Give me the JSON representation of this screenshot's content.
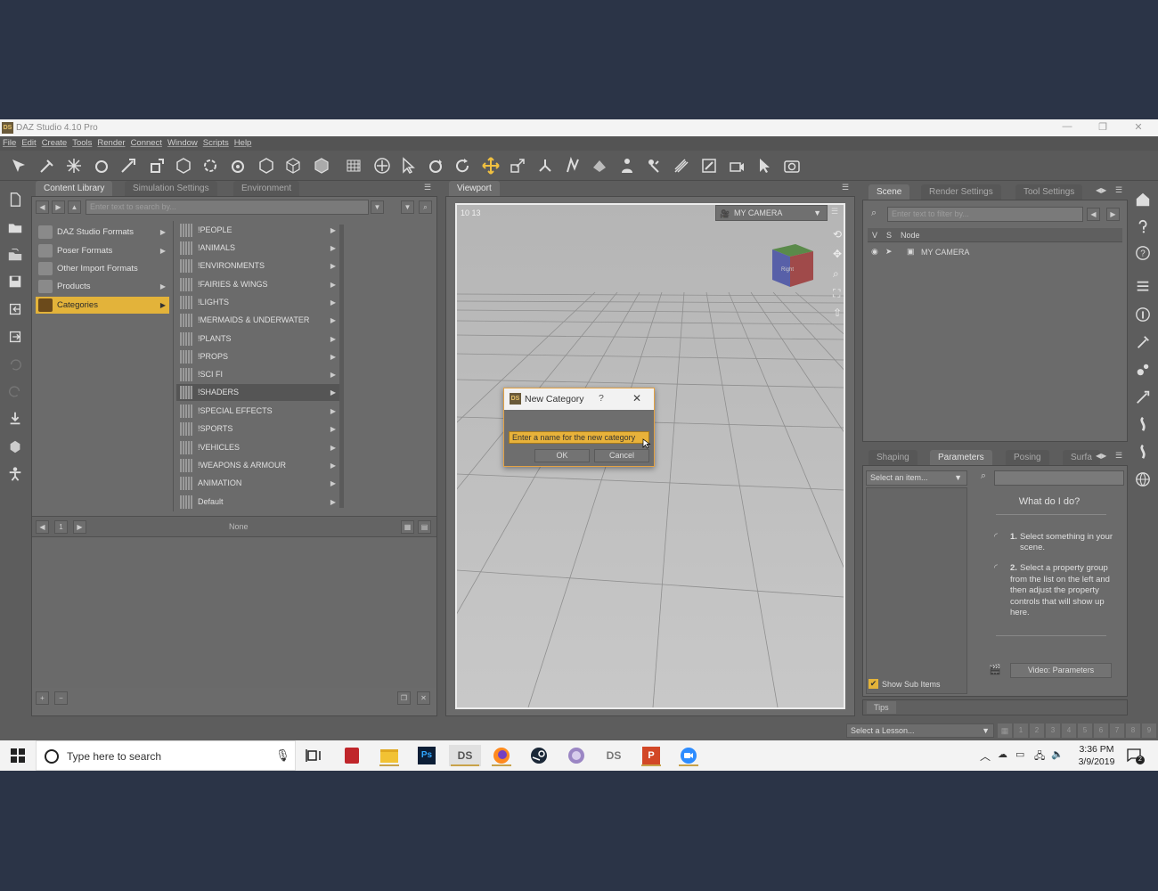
{
  "window": {
    "title": "DAZ Studio 4.10 Pro",
    "logo_text": "DS",
    "minimize": "—",
    "restore": "❐",
    "close": "✕"
  },
  "menu": [
    "File",
    "Edit",
    "Create",
    "Tools",
    "Render",
    "Connect",
    "Window",
    "Scripts",
    "Help"
  ],
  "content_library": {
    "tabs": [
      "Content Library",
      "Simulation Settings",
      "Environment"
    ],
    "search_placeholder": "Enter text to search by...",
    "sources": [
      {
        "label": "DAZ Studio Formats"
      },
      {
        "label": "Poser Formats"
      },
      {
        "label": "Other Import Formats"
      },
      {
        "label": "Products"
      },
      {
        "label": "Categories"
      }
    ],
    "categories": [
      "!PEOPLE",
      "!ANIMALS",
      "!ENVIRONMENTS",
      "!FAIRIES & WINGS",
      "!LIGHTS",
      "!MERMAIDS & UNDERWATER",
      "!PLANTS",
      "!PROPS",
      "!SCI FI",
      "!SHADERS",
      "!SPECIAL EFFECTS",
      "!SPORTS",
      "!VEHICLES",
      "!WEAPONS & ARMOUR",
      "ANIMATION",
      "Default"
    ],
    "page_number": "1",
    "filter_label": "None"
  },
  "viewport": {
    "tab": "Viewport",
    "info_text": "10  13",
    "camera": "MY CAMERA",
    "cube_label": "Right"
  },
  "dialog": {
    "logo_text": "DS",
    "title": "New Category",
    "help": "?",
    "close": "✕",
    "input_value": "Enter a name for the new category",
    "ok": "OK",
    "cancel": "Cancel"
  },
  "scene": {
    "tabs": [
      "Scene",
      "Render Settings",
      "Tool Settings"
    ],
    "filter_placeholder": "Enter text to filter by...",
    "col_v": "V",
    "col_s": "S",
    "col_node": "Node",
    "node": "MY CAMERA"
  },
  "parameters": {
    "tabs": [
      "Shaping",
      "Parameters",
      "Posing",
      "Surfa"
    ],
    "select_item": "Select an item...",
    "heading": "What do I do?",
    "step1_num": "1.",
    "step1_text": "Select something in your scene.",
    "step2_num": "2.",
    "step2_text": "Select a property group from the list on the left and then adjust the property controls that will show up here.",
    "show_sub_items": "Show Sub Items",
    "video_button": "Video: Parameters",
    "tips": "Tips"
  },
  "lesson": {
    "select": "Select a Lesson...",
    "pages": [
      "1",
      "2",
      "3",
      "4",
      "5",
      "6",
      "7",
      "8",
      "9"
    ]
  },
  "taskbar": {
    "search_placeholder": "Type here to search",
    "time": "3:36 PM",
    "date": "3/9/2019",
    "notification_count": "2",
    "ps_label": "Ps",
    "ds_label": "DS",
    "ds2_label": "DS",
    "ppt_label": "P"
  },
  "colors": {
    "accent": "#e3b33a",
    "desktop": "#2b3447",
    "panel": "#6b6b6b"
  }
}
